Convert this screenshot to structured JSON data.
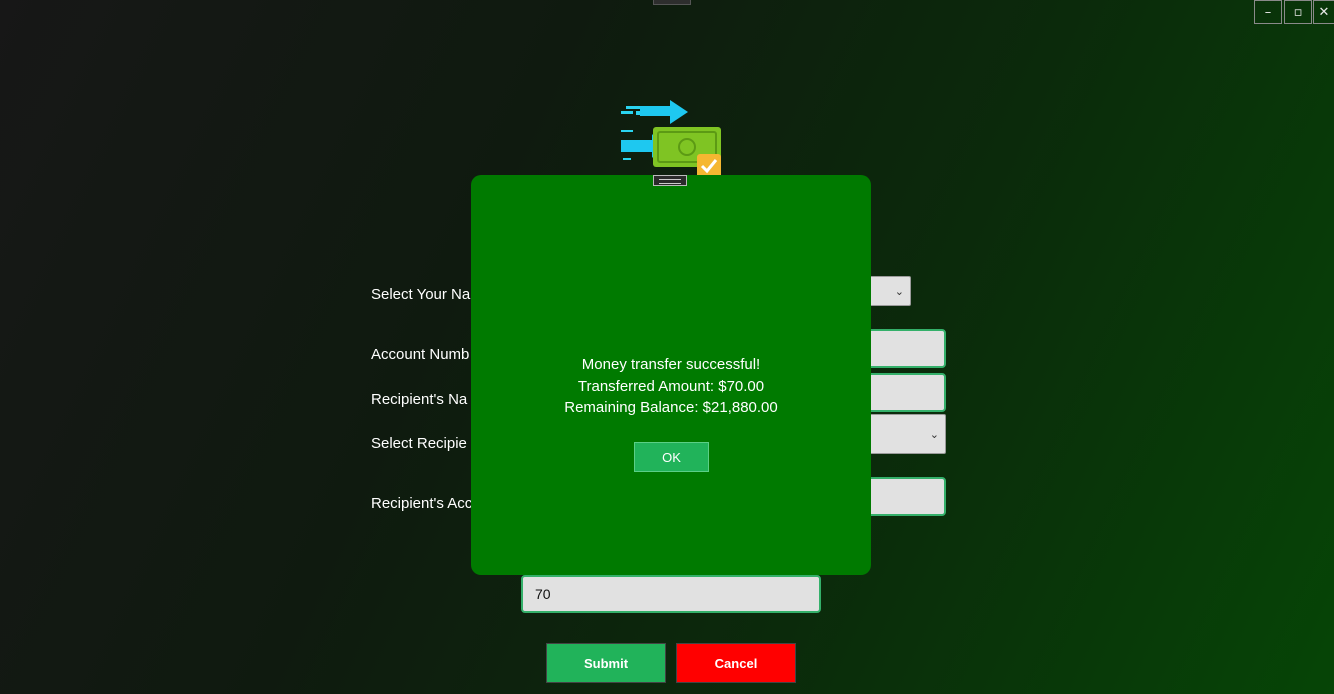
{
  "window": {
    "minimize_icon": "–",
    "maximize_icon": "▫",
    "close_icon": "✕"
  },
  "form": {
    "select_name_label": "Select Your Na",
    "account_number_label": "Account Numb",
    "recipient_name_label": "Recipient's Na",
    "select_recipient_label": "Select Recipie",
    "recipient_account_label": "Recipient's Acc",
    "amount_value": "70",
    "submit_label": "Submit",
    "cancel_label": "Cancel"
  },
  "dialog": {
    "line1": "Money transfer successful!",
    "line2": "Transferred Amount: $70.00",
    "line3": "Remaining Balance: $21,880.00",
    "ok_label": "OK"
  },
  "colors": {
    "dialog_bg": "#007a00",
    "submit_bg": "#21b35a",
    "cancel_bg": "#ff0000"
  }
}
